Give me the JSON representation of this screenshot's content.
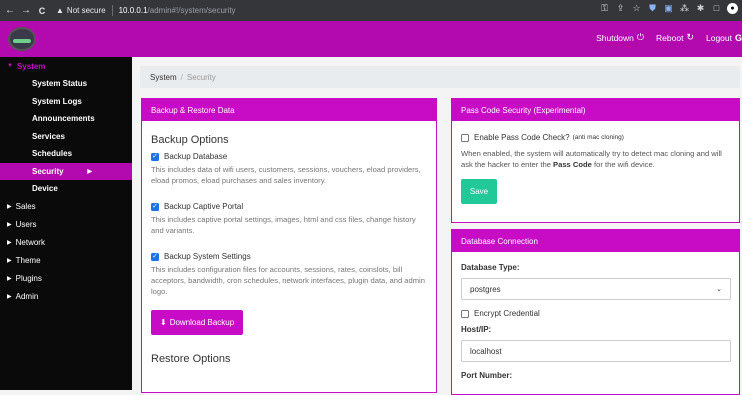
{
  "browser": {
    "back": "←",
    "forward": "→",
    "reload": "C",
    "not_secure_icon": "▲",
    "not_secure": "Not secure",
    "host": "10.0.0.1",
    "path": "/admin#!/system/security",
    "ext_icons": [
      "key-icon",
      "share-icon",
      "star-icon",
      "shield-icon",
      "translate-icon",
      "puzzle-icon",
      "pin-icon",
      "window-icon",
      "profile-avatar"
    ]
  },
  "topbar": {
    "shutdown": "Shutdown",
    "reboot": "Reboot",
    "logout": "Logout",
    "brand_color": "#b30ab0"
  },
  "sidebar": {
    "system": "System",
    "system_items": [
      "System Status",
      "System Logs",
      "Announcements",
      "Services",
      "Schedules",
      "Security",
      "Device"
    ],
    "groups": [
      "Sales",
      "Users",
      "Network",
      "Theme",
      "Plugins",
      "Admin"
    ]
  },
  "breadcrumb": {
    "parent": "System",
    "current": "Security"
  },
  "backup": {
    "header": "Backup & Restore Data",
    "title": "Backup Options",
    "db_label": "Backup Database",
    "db_desc": "This includes data of wifi users, customers, sessions, vouchers, eload providers, eload promos, eload purchases and sales inventory.",
    "portal_label": "Backup Captive Portal",
    "portal_desc": "This includes captive portal settings, images, html and css files, change history and variants.",
    "settings_label": "Backup System Settings",
    "settings_desc": "This includes configuration files for accounts, sessions, rates, coinslots, bill acceptors, bandwidth, cron schedules, network interfaces, plugin data, and admin logo.",
    "download_btn": "Download Backup",
    "restore_title": "Restore Options"
  },
  "passcode": {
    "header": "Pass Code Security (Experimental)",
    "check_label": "Enable Pass Code Check?",
    "check_note": "(anti mac cloning)",
    "desc_before": "When enabled, the system will automatically try to detect mac cloning and will ask the hacker to enter the",
    "desc_bold": "Pass Code",
    "desc_after": "for the wifi device.",
    "save_btn": "Save"
  },
  "db": {
    "header": "Database Connection",
    "type_label": "Database Type:",
    "type_value": "postgres",
    "encrypt_label": "Encrypt Credential",
    "host_label": "Host/IP:",
    "host_value": "localhost",
    "port_label": "Port Number:"
  }
}
